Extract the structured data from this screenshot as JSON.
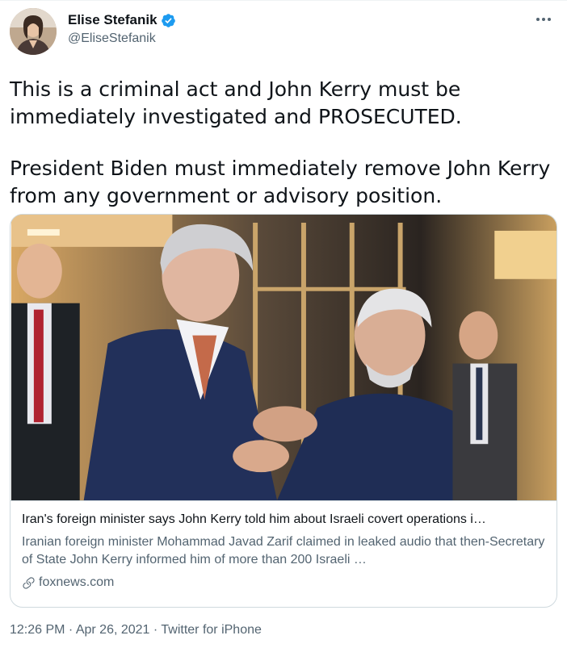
{
  "author": {
    "display_name": "Elise Stefanik",
    "handle": "@EliseStefanik",
    "verified": true
  },
  "tweet": {
    "paragraphs": [
      "This is a criminal act and John Kerry must be immediately investigated and PROSECUTED.",
      "President Biden must immediately remove John Kerry from any government or advisory position."
    ]
  },
  "card": {
    "title": "Iran's foreign minister says John Kerry told him about Israeli covert operations i…",
    "description": "Iranian foreign minister Mohammad Javad Zarif claimed in leaked audio that then-Secretary of State John Kerry informed him of more than 200 Israeli …",
    "source": "foxnews.com"
  },
  "footer": {
    "time": "12:26 PM",
    "date": "Apr 26, 2021",
    "client": "Twitter for iPhone",
    "separator": " · "
  },
  "colors": {
    "verified_badge": "#1d9bf0",
    "secondary_text": "#536471",
    "border": "#cfd9de"
  }
}
